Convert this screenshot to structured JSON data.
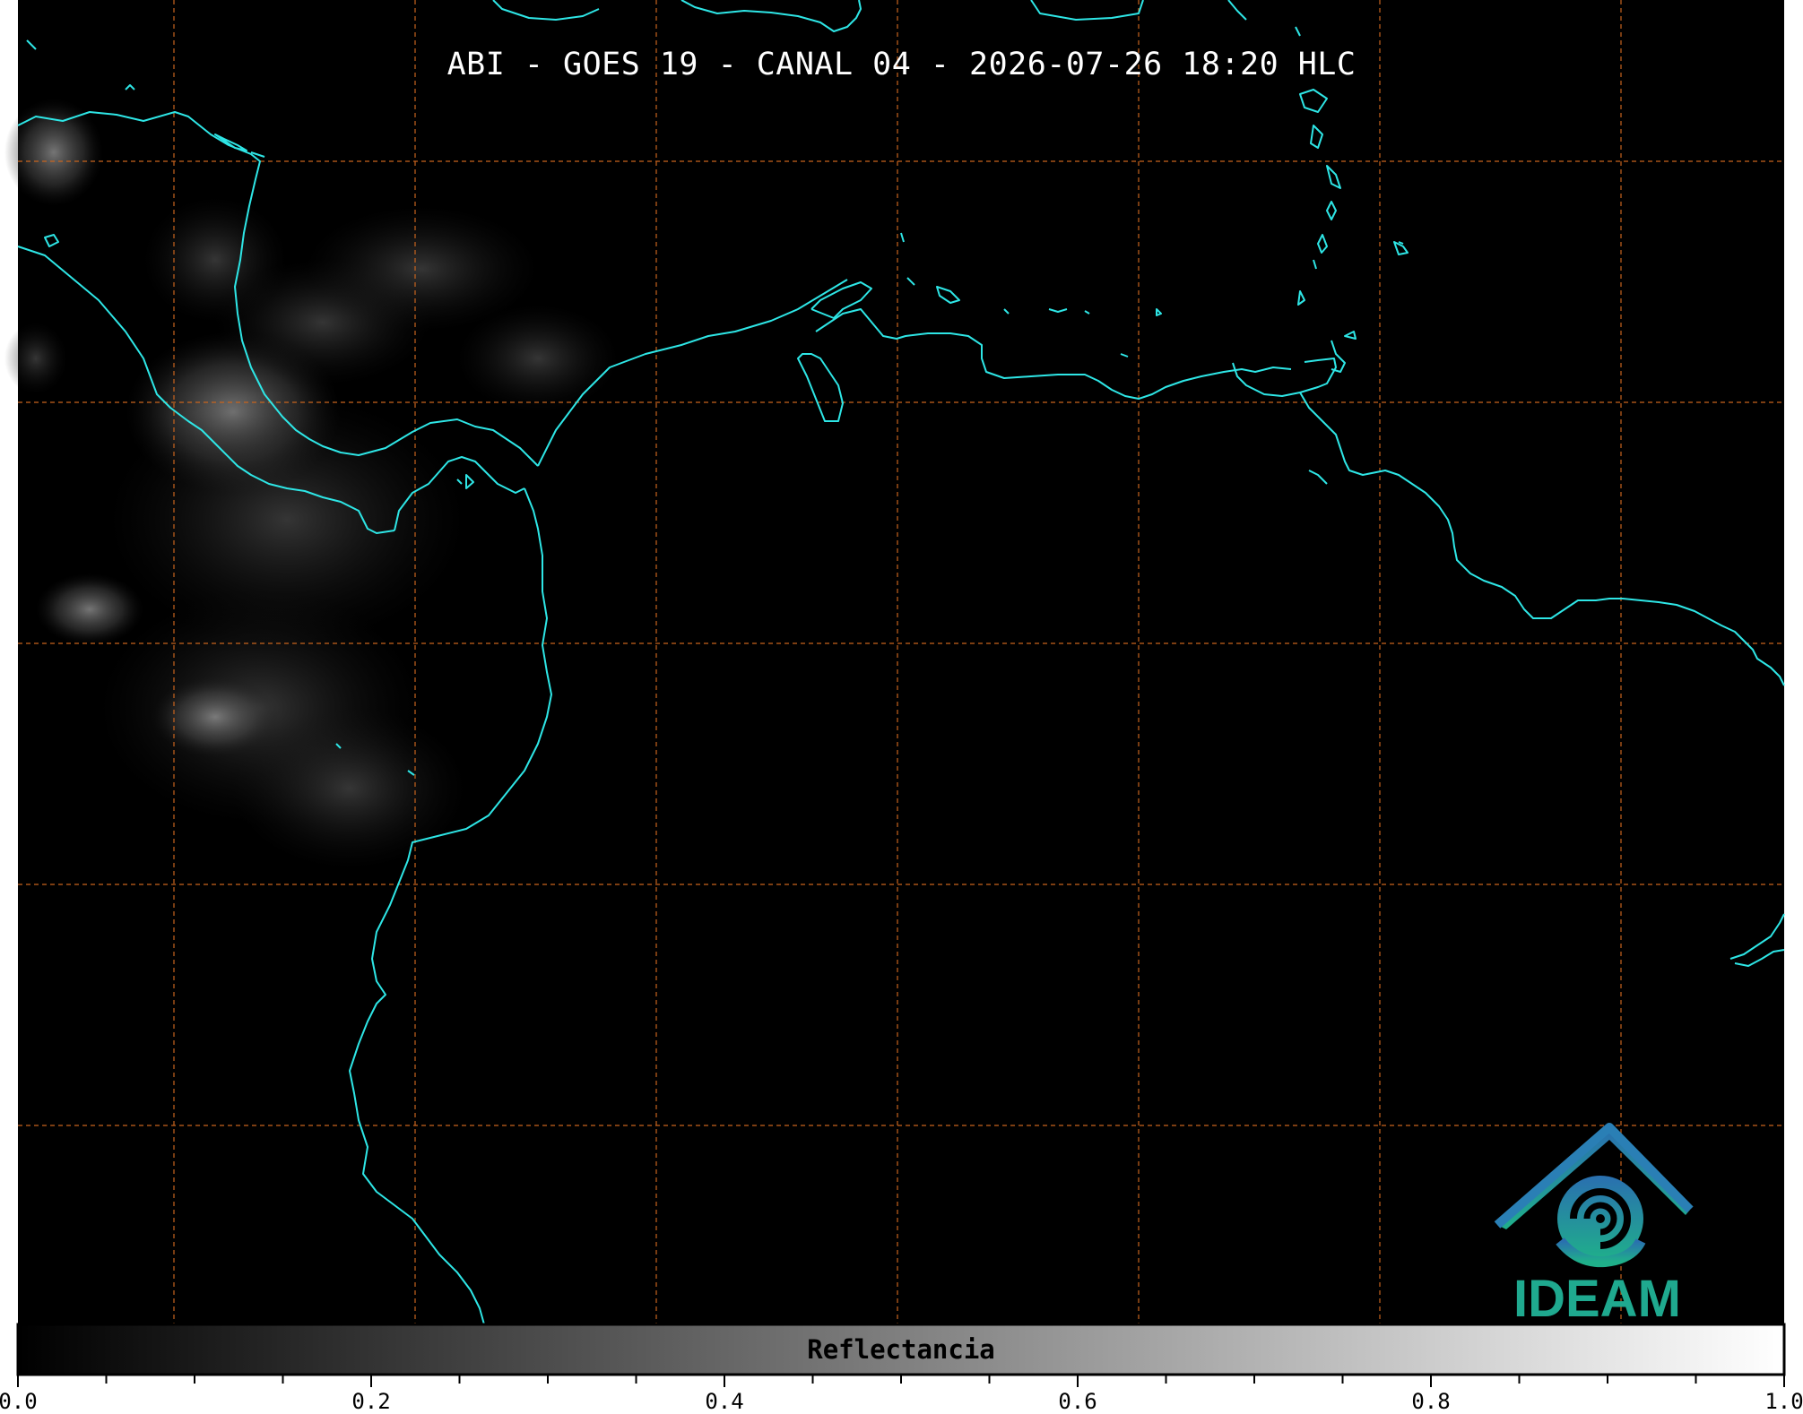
{
  "map": {
    "title": "ABI - GOES 19 - CANAL 04 - 2026-07-26 18:20 HLC",
    "colors": {
      "background": "#000000",
      "coastline": "#2ee6e6",
      "gridline": "#c8641e",
      "logo_primary": "#1f9ea0",
      "logo_text": "#1fa98f"
    },
    "logo": {
      "text": "IDEAM",
      "icon": "ideam-logo-icon"
    },
    "colorbar": {
      "label": "Reflectancia",
      "scale": "grayscale",
      "range": [
        0.0,
        1.0
      ],
      "tick_labels": [
        "0.0",
        "0.2",
        "0.4",
        "0.6",
        "0.8",
        "1.0"
      ],
      "tick_values": [
        0.0,
        0.2,
        0.4,
        0.6,
        0.8,
        1.0
      ],
      "minor_step": 0.05
    }
  }
}
